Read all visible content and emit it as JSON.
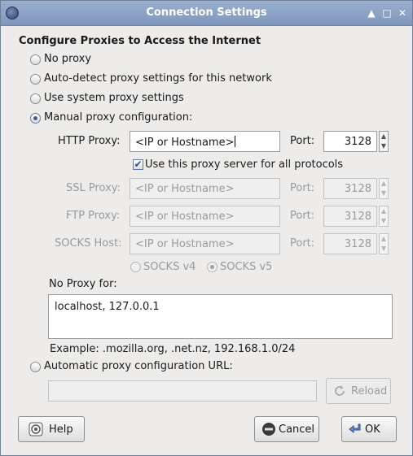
{
  "window": {
    "title": "Connection Settings"
  },
  "heading": "Configure Proxies to Access the Internet",
  "options": {
    "no_proxy": "No proxy",
    "auto_detect": "Auto-detect proxy settings for this network",
    "system": "Use system proxy settings",
    "manual": "Manual proxy configuration:",
    "auto_url": "Automatic proxy configuration URL:"
  },
  "selected_option": "manual",
  "proxies": {
    "http": {
      "label": "HTTP Proxy:",
      "value": "<IP or Hostname>",
      "port_label": "Port:",
      "port": "3128"
    },
    "share_all": {
      "label": "Use this proxy server for all protocols",
      "checked": true
    },
    "ssl": {
      "label": "SSL Proxy:",
      "value": "<IP or Hostname>",
      "port_label": "Port:",
      "port": "3128"
    },
    "ftp": {
      "label": "FTP Proxy:",
      "value": "<IP or Hostname>",
      "port_label": "Port:",
      "port": "3128"
    },
    "socks": {
      "label": "SOCKS Host:",
      "value": "<IP or Hostname>",
      "port_label": "Port:",
      "port": "3128"
    },
    "socks_v4": "SOCKS v4",
    "socks_v5": "SOCKS v5"
  },
  "no_proxy": {
    "label": "No Proxy for:",
    "value": "localhost, 127.0.0.1",
    "example": "Example: .mozilla.org, .net.nz, 192.168.1.0/24"
  },
  "auto_url": {
    "value": ""
  },
  "buttons": {
    "reload": "Reload",
    "help": "Help",
    "cancel": "Cancel",
    "ok": "OK"
  },
  "icons": {
    "app": "firefox-icon",
    "reload": "reload-icon",
    "help": "help-icon",
    "cancel": "cancel-icon",
    "ok": "ok-arrow-icon"
  }
}
